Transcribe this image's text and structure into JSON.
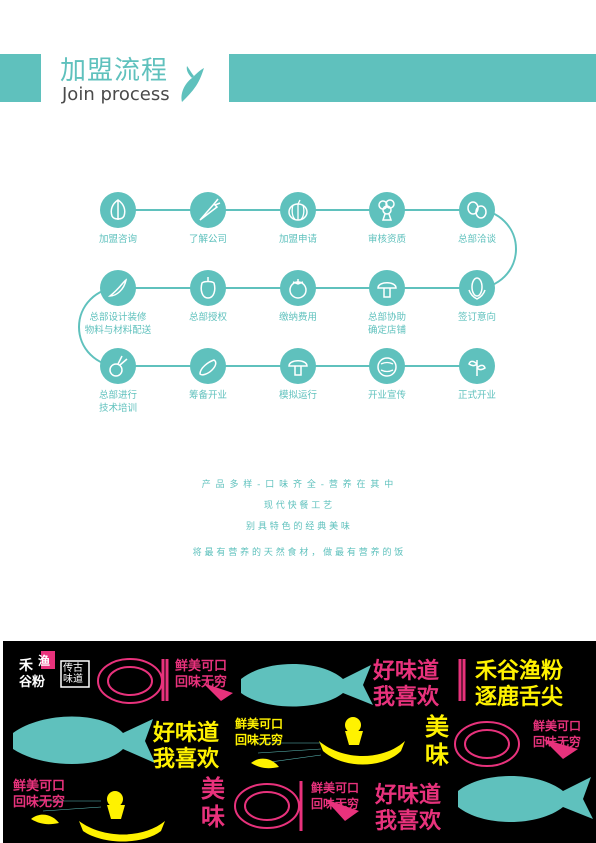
{
  "header": {
    "title_cn": "加盟流程",
    "title_en": "Join process"
  },
  "steps": [
    {
      "label": "加盟咨询",
      "icon": "garlic-icon"
    },
    {
      "label": "了解公司",
      "icon": "carrot-icon"
    },
    {
      "label": "加盟申请",
      "icon": "pumpkin-icon"
    },
    {
      "label": "审核资质",
      "icon": "broccoli-icon"
    },
    {
      "label": "总部洽谈",
      "icon": "peas-icon"
    },
    {
      "label": "签订意向",
      "icon": "corn-icon"
    },
    {
      "label": "总部协助\n确定店铺",
      "icon": "mushroom-icon"
    },
    {
      "label": "缴纳费用",
      "icon": "tomato-icon"
    },
    {
      "label": "总部授权",
      "icon": "pepper-icon"
    },
    {
      "label": "总部设计装修\n物料与材料配送",
      "icon": "chili-icon"
    },
    {
      "label": "总部进行\n技术培训",
      "icon": "radish-icon"
    },
    {
      "label": "筹备开业",
      "icon": "eggplant-icon"
    },
    {
      "label": "模拟运行",
      "icon": "mushroom-icon"
    },
    {
      "label": "开业宣传",
      "icon": "cabbage-icon"
    },
    {
      "label": "正式开业",
      "icon": "herb-icon"
    }
  ],
  "taglines": [
    "产 品 多 样 - 口 味 齐 全 - 营 养 在 其 中",
    "现 代 快 餐 工 艺",
    "别 具 特 色 的 经 典 美 味",
    "将 最 有 营 养 的 天 然 食 材 ， 做 最 有 营 养 的 饭"
  ],
  "banner": {
    "brand_top": "禾",
    "brand_mark": "渔",
    "brand_bottom": "谷粉",
    "seal": "传古味道",
    "slogan_a_1": "鲜美可口",
    "slogan_a_2": "回味无穷",
    "slogan_b_1": "好味道",
    "slogan_b_2": "我喜欢",
    "slogan_c_1": "禾谷渔粉",
    "slogan_c_2": "逐鹿舌尖",
    "slogan_d": "美味"
  },
  "colors": {
    "teal": "#5fc1bd",
    "magenta": "#e8327c",
    "yellow": "#fff200",
    "black": "#000000"
  }
}
